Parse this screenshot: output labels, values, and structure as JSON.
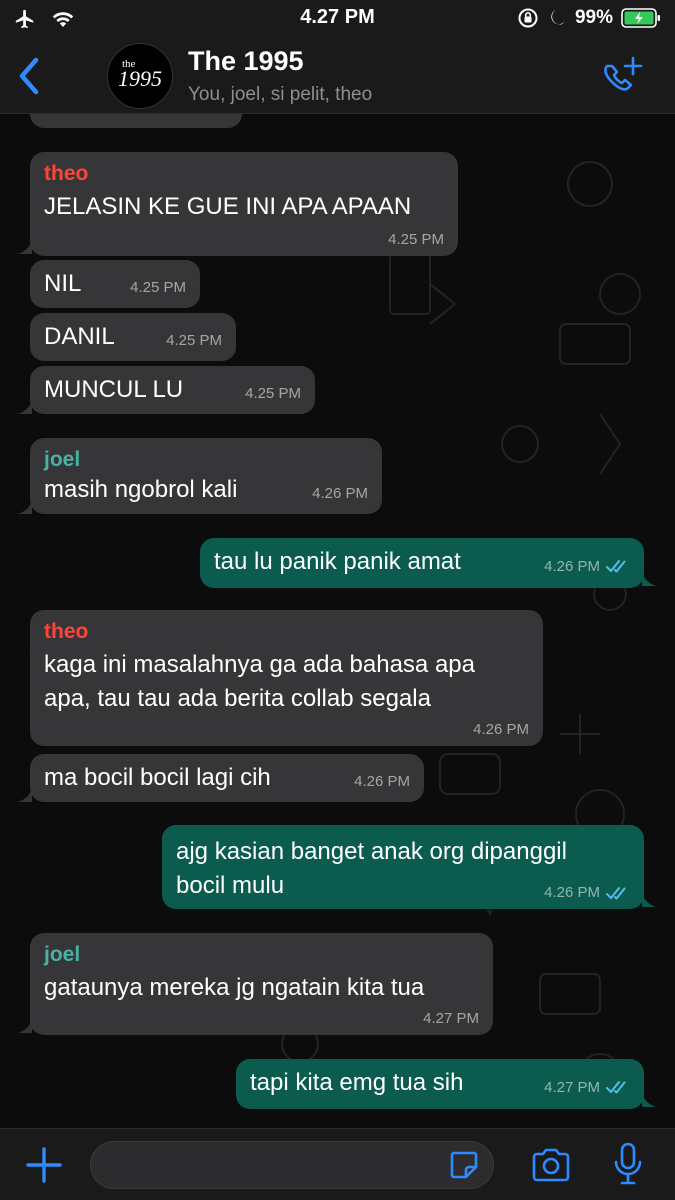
{
  "status_bar": {
    "time": "4.27 PM",
    "battery_percent": "99%"
  },
  "header": {
    "title": "The 1995",
    "subtitle": "You, joel, si pelit, theo",
    "avatar_text_small": "the",
    "avatar_text_large": "1995"
  },
  "colors": {
    "theo": "#ff453a",
    "joel": "#46b3a5",
    "incoming_bubble": "#363638",
    "outgoing_bubble": "#0b5c4f",
    "ticks": "#53bdeb"
  },
  "messages": [
    {
      "sender": "theo",
      "text": "JELASIN KE GUE INI APA APAAN",
      "time": "4.25 PM",
      "direction": "in"
    },
    {
      "text": "NIL",
      "time": "4.25 PM",
      "direction": "in"
    },
    {
      "text": "DANIL",
      "time": "4.25 PM",
      "direction": "in"
    },
    {
      "text": "MUNCUL LU",
      "time": "4.25 PM",
      "direction": "in"
    },
    {
      "sender": "joel",
      "text": "masih ngobrol kali",
      "time": "4.26 PM",
      "direction": "in"
    },
    {
      "text": "tau lu panik panik amat",
      "time": "4.26 PM",
      "direction": "out",
      "status": "read"
    },
    {
      "sender": "theo",
      "text_line1": "kaga ini masalahnya ga ada bahasa apa",
      "text_line2": "apa, tau tau ada berita collab segala",
      "time": "4.26 PM",
      "direction": "in"
    },
    {
      "text": "ma bocil bocil lagi cih",
      "time": "4.26 PM",
      "direction": "in"
    },
    {
      "text_line1": "ajg kasian banget anak org dipanggil",
      "text_line2": "bocil mulu",
      "time": "4.26 PM",
      "direction": "out",
      "status": "read"
    },
    {
      "sender": "joel",
      "text": "gataunya mereka jg ngatain kita tua",
      "time": "4.27 PM",
      "direction": "in"
    },
    {
      "text": "tapi kita emg tua sih",
      "time": "4.27 PM",
      "direction": "out",
      "status": "read"
    }
  ],
  "input": {
    "placeholder": "",
    "value": ""
  },
  "icons": [
    "airplane-icon",
    "wifi-icon",
    "orientation-lock-icon",
    "moon-icon",
    "battery-icon",
    "back-icon",
    "add-call-icon",
    "plus-icon",
    "sticker-icon",
    "camera-icon",
    "mic-icon",
    "read-ticks-icon"
  ]
}
